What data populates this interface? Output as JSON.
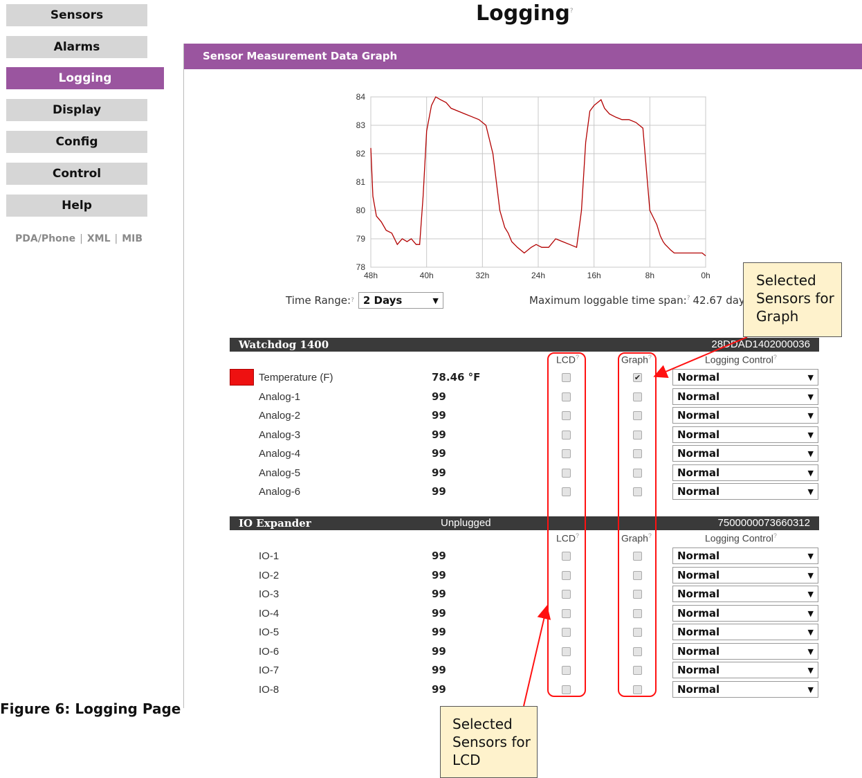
{
  "sidebar": {
    "items": [
      {
        "label": "Sensors",
        "active": false
      },
      {
        "label": "Alarms",
        "active": false
      },
      {
        "label": "Logging",
        "active": true
      },
      {
        "label": "Display",
        "active": false
      },
      {
        "label": "Config",
        "active": false
      },
      {
        "label": "Control",
        "active": false
      },
      {
        "label": "Help",
        "active": false
      }
    ],
    "links": [
      "PDA/Phone",
      "XML",
      "MIB"
    ]
  },
  "page": {
    "title": "Logging",
    "help_mark": "?"
  },
  "panel": {
    "title": "Sensor Measurement Data Graph"
  },
  "chart_data": {
    "type": "line",
    "title": "",
    "xlabel": "",
    "ylabel": "",
    "x_ticks": [
      "48h",
      "40h",
      "32h",
      "24h",
      "16h",
      "8h",
      "0h"
    ],
    "y_ticks": [
      78,
      79,
      80,
      81,
      82,
      83,
      84
    ],
    "ylim": [
      78,
      84
    ],
    "xlim": [
      48,
      0
    ],
    "grid": true,
    "series": [
      {
        "color": "#b20000",
        "x": [
          48,
          47.7,
          47.2,
          46.5,
          45.8,
          45.0,
          44.2,
          43.5,
          42.8,
          42.2,
          41.5,
          41.0,
          40.5,
          40.0,
          39.3,
          38.7,
          38.0,
          37.2,
          36.5,
          35.5,
          34.5,
          33.5,
          32.5,
          31.5,
          30.5,
          29.5,
          28.8,
          28.3,
          27.8,
          27.0,
          26.0,
          25.0,
          24.3,
          23.5,
          22.5,
          21.5,
          20.5,
          19.5,
          18.5,
          17.8,
          17.2,
          16.6,
          16.0,
          15.5,
          15.0,
          14.5,
          13.8,
          13.0,
          12.0,
          11.0,
          10.0,
          9.0,
          8.0,
          7.0,
          6.5,
          6.1,
          5.8,
          5.4,
          5.0,
          4.5,
          4.0,
          3.5,
          3.0,
          2.5,
          2.0,
          1.5,
          1.0,
          0.5,
          0
        ],
        "y": [
          82.2,
          80.5,
          79.8,
          79.6,
          79.3,
          79.2,
          78.8,
          79.0,
          78.9,
          79.0,
          78.8,
          78.8,
          80.5,
          82.8,
          83.7,
          84.0,
          83.9,
          83.8,
          83.6,
          83.5,
          83.4,
          83.3,
          83.2,
          83.0,
          82.0,
          80.0,
          79.4,
          79.2,
          78.9,
          78.7,
          78.5,
          78.7,
          78.8,
          78.7,
          78.7,
          79.0,
          78.9,
          78.8,
          78.7,
          80.0,
          82.4,
          83.5,
          83.7,
          83.8,
          83.9,
          83.6,
          83.4,
          83.3,
          83.2,
          83.2,
          83.1,
          82.9,
          80.0,
          79.5,
          79.1,
          78.9,
          78.8,
          78.7,
          78.6,
          78.5,
          78.5,
          78.5,
          78.5,
          78.5,
          78.5,
          78.5,
          78.5,
          78.5,
          78.4
        ]
      }
    ]
  },
  "time_range": {
    "label": "Time Range:",
    "value": "2 Days"
  },
  "max_span": {
    "label": "Maximum loggable time span:",
    "value": "42.67 days"
  },
  "groups": [
    {
      "name": "Watchdog 1400",
      "status": "",
      "serial": "28DDAD1402000036",
      "headers": {
        "lcd": "LCD",
        "graph": "Graph",
        "logging": "Logging Control"
      },
      "rows": [
        {
          "label": "Temperature (F)",
          "value": "78.46 °F",
          "swatch": "#ee1111",
          "lcd": false,
          "graph": true,
          "logging": "Normal"
        },
        {
          "label": "Analog-1",
          "value": "99",
          "lcd": false,
          "graph": false,
          "logging": "Normal"
        },
        {
          "label": "Analog-2",
          "value": "99",
          "lcd": false,
          "graph": false,
          "logging": "Normal"
        },
        {
          "label": "Analog-3",
          "value": "99",
          "lcd": false,
          "graph": false,
          "logging": "Normal"
        },
        {
          "label": "Analog-4",
          "value": "99",
          "lcd": false,
          "graph": false,
          "logging": "Normal"
        },
        {
          "label": "Analog-5",
          "value": "99",
          "lcd": false,
          "graph": false,
          "logging": "Normal"
        },
        {
          "label": "Analog-6",
          "value": "99",
          "lcd": false,
          "graph": false,
          "logging": "Normal"
        }
      ]
    },
    {
      "name": "IO Expander",
      "status": "Unplugged",
      "serial": "7500000073660312",
      "headers": {
        "lcd": "LCD",
        "graph": "Graph",
        "logging": "Logging Control"
      },
      "rows": [
        {
          "label": "IO-1",
          "value": "99",
          "lcd": false,
          "graph": false,
          "logging": "Normal"
        },
        {
          "label": "IO-2",
          "value": "99",
          "lcd": false,
          "graph": false,
          "logging": "Normal"
        },
        {
          "label": "IO-3",
          "value": "99",
          "lcd": false,
          "graph": false,
          "logging": "Normal"
        },
        {
          "label": "IO-4",
          "value": "99",
          "lcd": false,
          "graph": false,
          "logging": "Normal"
        },
        {
          "label": "IO-5",
          "value": "99",
          "lcd": false,
          "graph": false,
          "logging": "Normal"
        },
        {
          "label": "IO-6",
          "value": "99",
          "lcd": false,
          "graph": false,
          "logging": "Normal"
        },
        {
          "label": "IO-7",
          "value": "99",
          "lcd": false,
          "graph": false,
          "logging": "Normal"
        },
        {
          "label": "IO-8",
          "value": "99",
          "lcd": false,
          "graph": false,
          "logging": "Normal"
        }
      ]
    }
  ],
  "annotations": {
    "graph_callout": "Selected Sensors for Graph",
    "lcd_callout": "Selected Sensors for LCD"
  },
  "caption": "Figure 6: Logging Page",
  "colors": {
    "accent": "#9a559f",
    "group_bar": "#3a3a3a",
    "callout_line": "#ff1111",
    "callout_fill": "#fef2cc"
  }
}
